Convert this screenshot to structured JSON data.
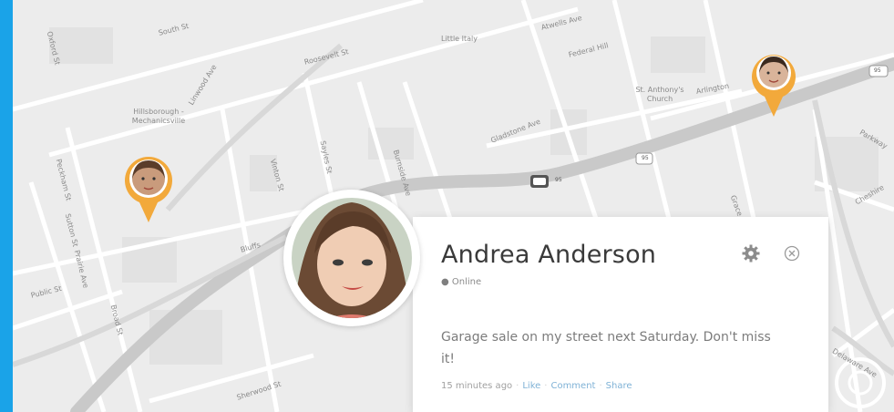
{
  "map": {
    "labels": [
      "South St",
      "Roosevelt St",
      "Little Italy",
      "Hillsborough - Mechanicsville",
      "St. Anthony's Church",
      "Gladstone Ave",
      "Sayles St",
      "Burnside Ave",
      "Arlington",
      "Parkway",
      "Cheshire",
      "Delaware Ave",
      "Sherwood St",
      "Peckham St",
      "Vinton St",
      "Broad St",
      "Prairie Ave",
      "Linwood Ave",
      "Bluffs",
      "Sutton St",
      "Public St",
      "Atwells Ave",
      "Federal Hill",
      "Grace St",
      "Oxford St"
    ],
    "road_badges": [
      "95",
      "95",
      "95"
    ]
  },
  "card": {
    "name": "Andrea Anderson",
    "status": "Online",
    "message": "Garage sale on my street next Saturday. Don't miss it!",
    "time": "15 minutes ago",
    "actions": [
      "Like",
      "Comment",
      "Share"
    ]
  },
  "colors": {
    "frame": "#1aa3e8",
    "pin": "#f2a93b",
    "card_bg": "#ffffff"
  }
}
